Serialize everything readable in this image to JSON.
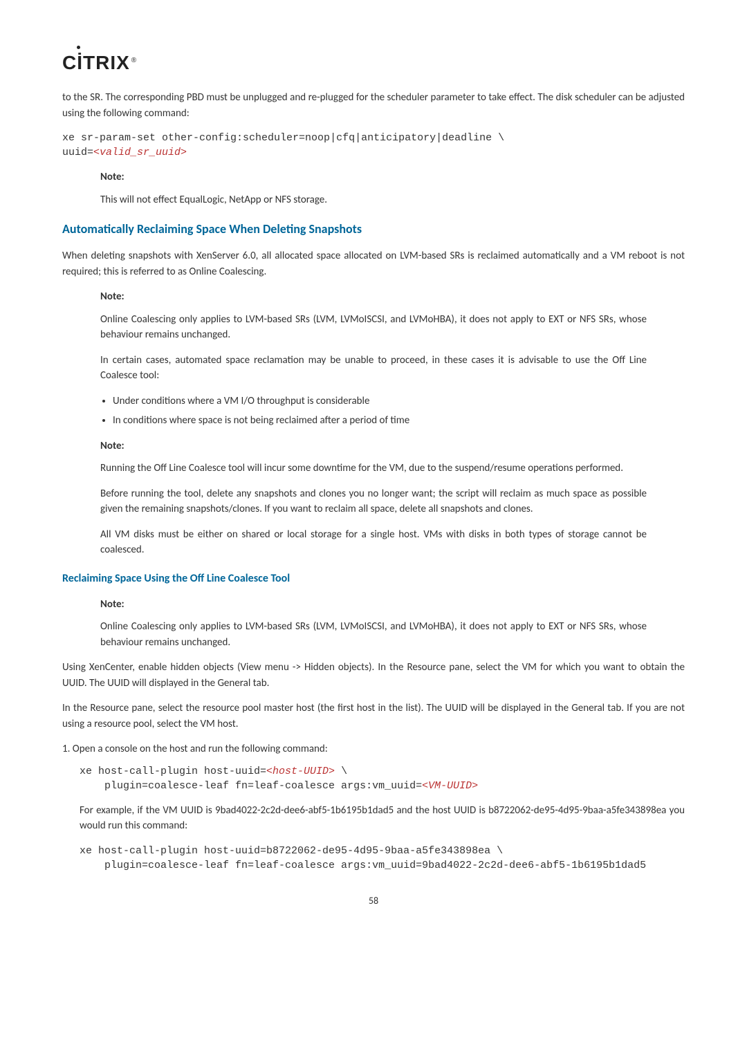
{
  "logo": "CİTRIX",
  "intro": {
    "p1": "to the SR. The corresponding PBD must be unplugged and re-plugged for the scheduler parameter to take effect. The disk scheduler can be adjusted using the following command:",
    "code_prefix": "xe sr-param-set other-config:scheduler=noop|cfq|anticipatory|deadline \\\nuuid=",
    "code_var": "<valid_sr_uuid>",
    "note_label": "Note:",
    "note_text": "This will not effect EqualLogic, NetApp or NFS storage."
  },
  "auto": {
    "title": "Automatically Reclaiming Space When Deleting Snapshots",
    "p1": "When deleting snapshots with XenServer 6.0, all allocated space allocated on LVM-based SRs is reclaimed automatically and a VM reboot is not required; this is referred to as Online Coalescing.",
    "note1_label": "Note:",
    "note1_p1": "Online Coalescing only applies to LVM-based SRs (LVM, LVMoISCSI, and LVMoHBA), it does not apply to EXT or NFS SRs, whose behaviour remains unchanged.",
    "note1_p2": "In certain cases, automated space reclamation may be unable to proceed, in these cases it is advisable to use the Off Line Coalesce tool:",
    "bullets": [
      "Under conditions where a VM I/O throughput is considerable",
      "In conditions where space is not being reclaimed after a period of time"
    ],
    "note2_label": "Note:",
    "note2_p1": "Running the Off Line Coalesce tool will incur some downtime for the VM, due to the suspend/resume operations performed.",
    "note2_p2": "Before running the tool, delete any snapshots and clones you no longer want; the script will reclaim as much space as possible given the remaining snapshots/clones. If you want to reclaim all space, delete all snapshots and clones.",
    "note2_p3": "All VM disks must be either on shared or local storage for a single host. VMs with disks in both types of storage cannot be coalesced."
  },
  "reclaim": {
    "title": "Reclaiming Space Using the Off Line Coalesce Tool",
    "note_label": "Note:",
    "note_p1": "Online Coalescing only applies to LVM-based SRs (LVM, LVMoISCSI, and LVMoHBA), it does not apply to EXT or NFS SRs, whose behaviour remains unchanged.",
    "p1": "Using XenCenter, enable hidden objects (View menu -> Hidden objects). In the Resource pane, select the VM for which you want to obtain the UUID. The UUID will displayed in the General tab.",
    "p2": "In the Resource pane, select the resource pool master host (the first host in the list). The UUID will be displayed in the General tab. If you are not using a resource pool, select the VM host.",
    "step1_label": "1.  Open a console on the host and run the following command:",
    "step1_code_l1a": "xe host-call-plugin host-uuid=",
    "step1_code_l1v": "<host-UUID>",
    "step1_code_l1b": " \\",
    "step1_code_l2a": "    plugin=coalesce-leaf fn=leaf-coalesce args:vm_uuid=",
    "step1_code_l2v": "<VM-UUID>",
    "step1_p": "For example, if the VM UUID is 9bad4022-2c2d-dee6-abf5-1b6195b1dad5 and the host UUID is b8722062-de95-4d95-9baa-a5fe343898ea you would run this command:",
    "step1_code2": "xe host-call-plugin host-uuid=b8722062-de95-4d95-9baa-a5fe343898ea \\\n    plugin=coalesce-leaf fn=leaf-coalesce args:vm_uuid=9bad4022-2c2d-dee6-abf5-1b6195b1dad5"
  },
  "page": "58"
}
